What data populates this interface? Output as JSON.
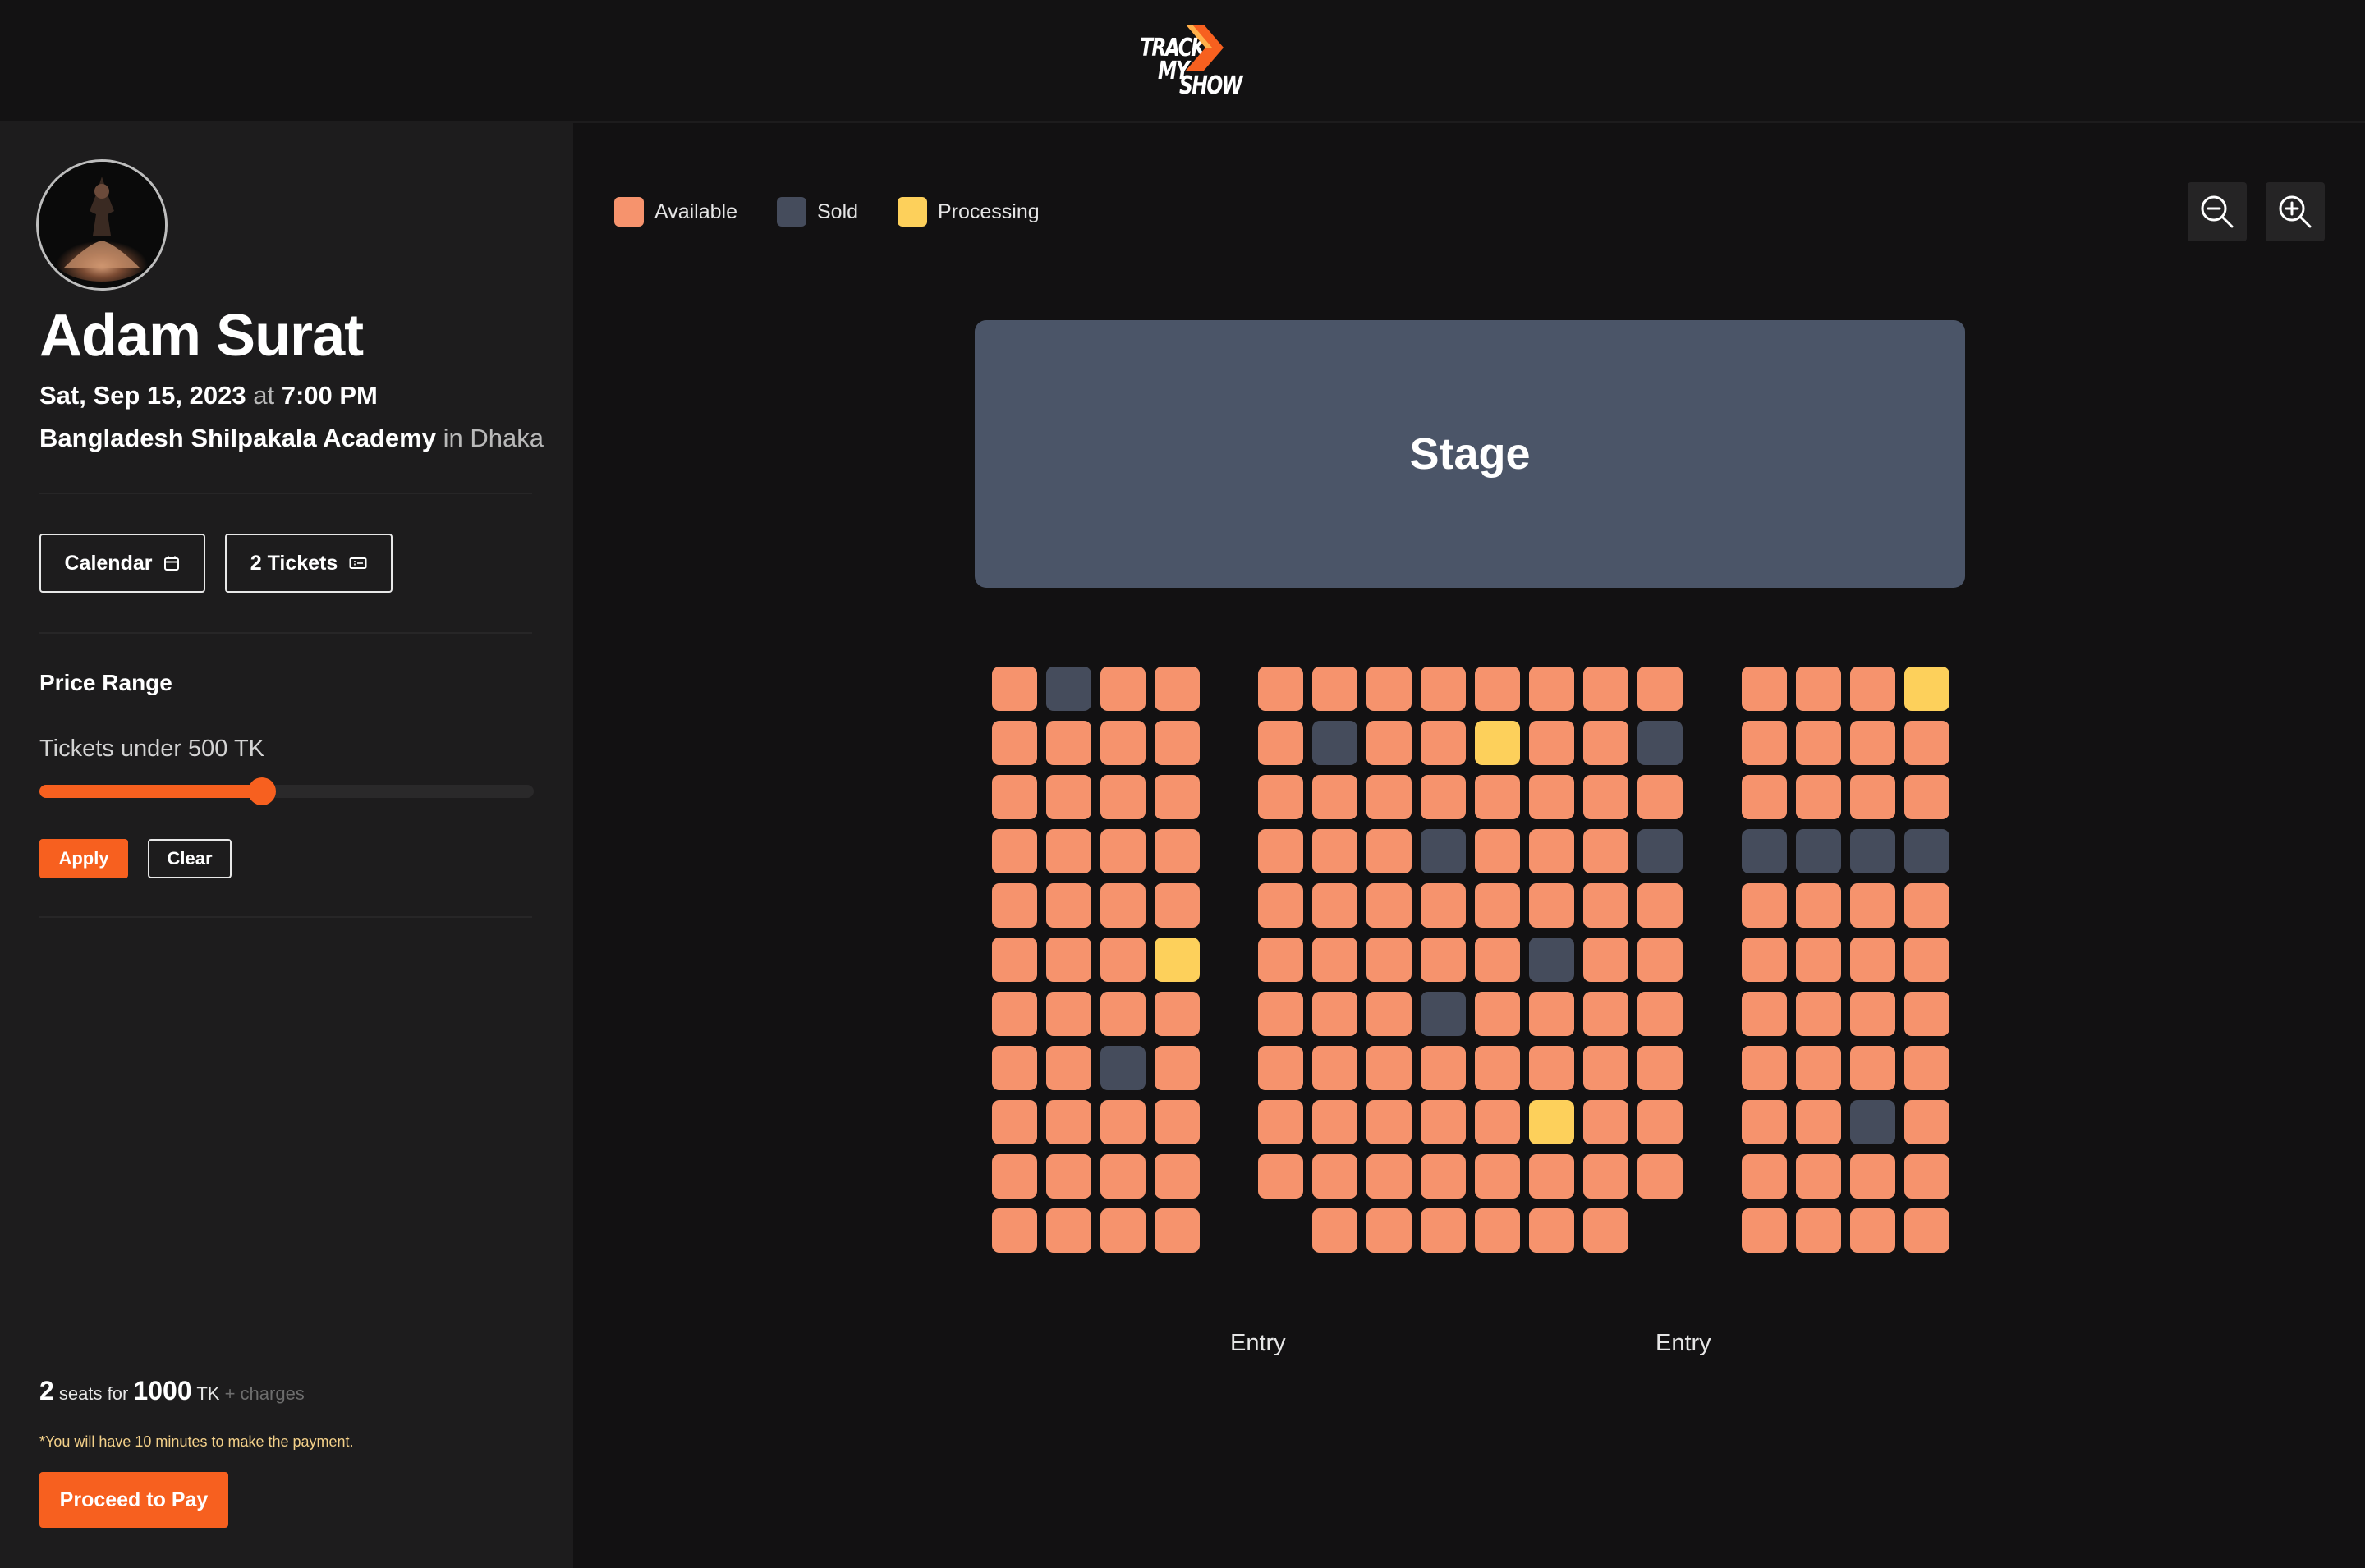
{
  "header": {
    "logo_lines": [
      "TRACK",
      "MY",
      "SHOW"
    ],
    "brand_color": "#f7601f"
  },
  "event": {
    "artist": "Adam Surat",
    "date": "Sat, Sep 15, 2023",
    "at_word": "at",
    "time": "7:00 PM",
    "venue": "Bangladesh Shilpakala Academy",
    "in_word": "in",
    "city": "Dhaka"
  },
  "actions": {
    "calendar_label": "Calendar",
    "calendar_icon": "calendar-icon",
    "tickets_label": "2 Tickets",
    "tickets_icon": "ticket-icon"
  },
  "filter": {
    "title": "Price Range",
    "label": "Tickets under 500 TK",
    "slider_value": 0.45,
    "apply_label": "Apply",
    "clear_label": "Clear"
  },
  "summary": {
    "seat_count": "2",
    "seats_for_text": "seats for",
    "amount": "1000",
    "currency": "TK",
    "charges_text": "+ charges",
    "note": "*You will have 10 minutes to make the payment.",
    "pay_label": "Proceed to Pay"
  },
  "legend": [
    {
      "label": "Available",
      "status": "available",
      "color": "#f6936d"
    },
    {
      "label": "Sold",
      "status": "sold",
      "color": "#454c5c"
    },
    {
      "label": "Processing",
      "status": "processing",
      "color": "#fdd05b"
    }
  ],
  "zoom": {
    "zoom_out_icon": "zoom-out-icon",
    "zoom_in_icon": "zoom-in-icon"
  },
  "stage_label": "Stage",
  "entries": [
    "Entry",
    "Entry"
  ],
  "seat_map": {
    "legend_codes": {
      "A": "available",
      "S": "sold",
      "P": "processing",
      "-": "no seat"
    },
    "sections": [
      {
        "name": "left",
        "rows": [
          "ASAA",
          "AAAA",
          "AAAA",
          "AAAA",
          "AAAA",
          "AAAP",
          "AAAA",
          "AASA",
          "AAAA",
          "AAAA",
          "AAAA"
        ]
      },
      {
        "name": "center",
        "rows": [
          "AAAAAAAA",
          "ASAAPAAS",
          "AAAAAAAA",
          "AAASAAAS",
          "AAAAAAAA",
          "AAAAASAA",
          "AAASAAAA",
          "AAAAAAAA",
          "AAAAAPAA",
          "AAAAAAAA",
          "-AAAAAA-"
        ]
      },
      {
        "name": "right",
        "rows": [
          "AAAP",
          "AAAA",
          "AAAA",
          "SSSS",
          "AAAA",
          "AAAA",
          "AAAA",
          "AAAA",
          "AASA",
          "AAAA",
          "AAAA"
        ]
      }
    ]
  }
}
